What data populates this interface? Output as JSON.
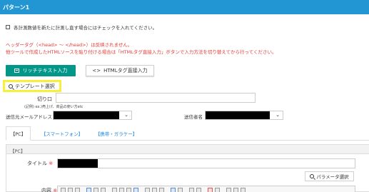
{
  "header": {
    "title": "パターン1"
  },
  "recalc": {
    "label": "各計測数値を新たに計測し直す場合にはチェックを入れてください。"
  },
  "warning": {
    "line1": "ヘッダータグ（<head> 〜 </head>）は反映されません。",
    "line2": "他ツールで作成したHTMLソースを貼り付ける場合は「HTMLタグ直接入力」ボタンで入力方法を切り替えてから行ってください。"
  },
  "editor_mode": {
    "rich_text_label": "リッチテキスト入力",
    "html_label": "HTMLタグ直接入力",
    "html_icon_text": "<>"
  },
  "template": {
    "label": "テンプレート選択"
  },
  "kirikuchi": {
    "label": "切り口",
    "example": "(記例) ex.)売上げ、商品の使い方etc"
  },
  "from_address": {
    "label": "送信元メールアドレス"
  },
  "sender_name": {
    "label": "送信者名"
  },
  "tabs": [
    {
      "label": "【PC】"
    },
    {
      "label": "【スマートフォン】"
    },
    {
      "label": "【携帯・ガラケー】"
    }
  ],
  "pc_panel": {
    "heading": "【PC】",
    "title_label": "タイトル",
    "required_mark": "※",
    "param_button_label": "パラメータ選択",
    "body_label": "内容"
  },
  "colors": {
    "header": "#2196d3",
    "rich_button": "#009688",
    "warning": "#e53935",
    "highlight": "#f6f03a",
    "tab_link": "#1e88e5"
  },
  "icons": {
    "rich_text": "editor-icon",
    "search": "search-icon",
    "select": "chevron-down-icon"
  }
}
